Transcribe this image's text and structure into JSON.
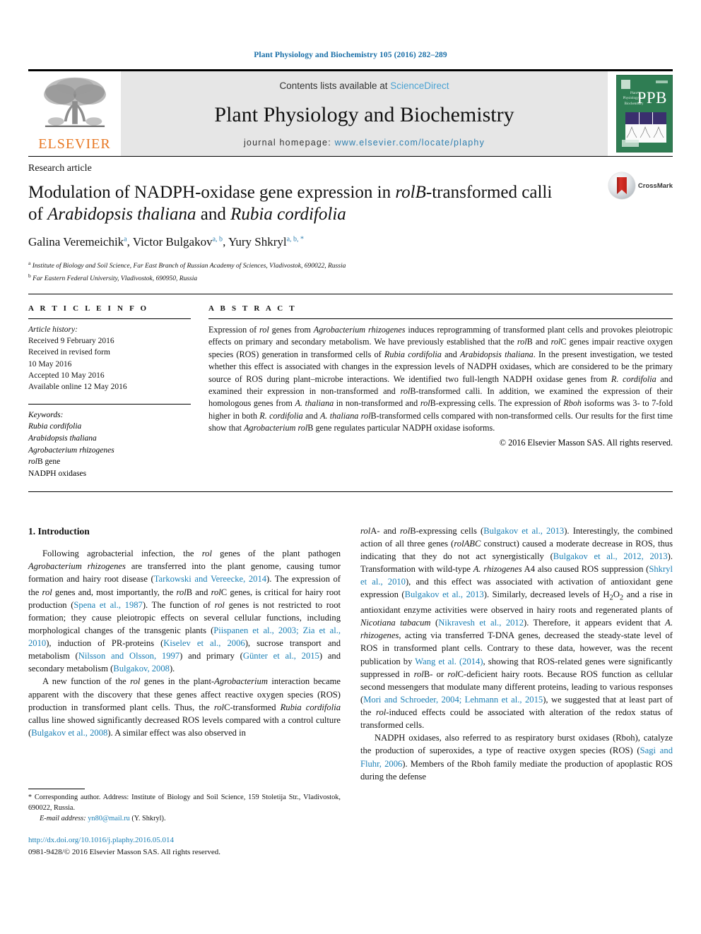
{
  "running_head": "Plant Physiology and Biochemistry 105 (2016) 282–289",
  "masthead": {
    "publisher_name": "ELSEVIER",
    "contents_prefix": "Contents lists available at ",
    "contents_link": "ScienceDirect",
    "journal_title": "Plant Physiology and Biochemistry",
    "homepage_prefix": "journal homepage: ",
    "homepage_link": "www.elsevier.com/locate/plaphy",
    "cover_acronym": "PPB",
    "cover_journal_name": "Plant Physiology and Biochemistry"
  },
  "article": {
    "type": "Research article",
    "title_part1": "Modulation of NADPH-oxidase gene expression in ",
    "title_italic1": "rolB",
    "title_part2": "-transformed calli of ",
    "title_italic2": "Arabidopsis thaliana",
    "title_part3": " and ",
    "title_italic3": "Rubia cordifolia",
    "authors": [
      {
        "name": "Galina Veremeichik",
        "sup": "a",
        "sep": ", "
      },
      {
        "name": "Victor Bulgakov",
        "sup": "a, b",
        "sep": ", "
      },
      {
        "name": "Yury Shkryl",
        "sup": "a, b, *",
        "sep": ""
      }
    ],
    "affiliations": [
      {
        "marker": "a",
        "text": "Institute of Biology and Soil Science, Far East Branch of Russian Academy of Sciences, Vladivostok, 690022, Russia"
      },
      {
        "marker": "b",
        "text": "Far Eastern Federal University, Vladivostok, 690950, Russia"
      }
    ],
    "crossmark_label": "CrossMark"
  },
  "info": {
    "heading": "A R T I C L E   I N F O",
    "history_label": "Article history:",
    "history": [
      "Received 9 February 2016",
      "Received in revised form",
      "10 May 2016",
      "Accepted 10 May 2016",
      "Available online 12 May 2016"
    ],
    "keywords_label": "Keywords:",
    "keywords": [
      {
        "text": "Rubia cordifolia",
        "italic": true
      },
      {
        "text": "Arabidopsis thaliana",
        "italic": true
      },
      {
        "text": "Agrobacterium rhizogenes",
        "italic": true
      },
      {
        "text": "rolB gene",
        "italic": false
      },
      {
        "text": "NADPH oxidases",
        "italic": false
      }
    ]
  },
  "abstract": {
    "heading": "A B S T R A C T",
    "body": "Expression of rol genes from Agrobacterium rhizogenes induces reprogramming of transformed plant cells and provokes pleiotropic effects on primary and secondary metabolism. We have previously established that the rolB and rolC genes impair reactive oxygen species (ROS) generation in transformed cells of Rubia cordifolia and Arabidopsis thaliana. In the present investigation, we tested whether this effect is associated with changes in the expression levels of NADPH oxidases, which are considered to be the primary source of ROS during plant–microbe interactions. We identified two full-length NADPH oxidase genes from R. cordifolia and examined their expression in non-transformed and rolB-transformed calli. In addition, we examined the expression of their homologous genes from A. thaliana in non-transformed and rolB-expressing cells. The expression of Rboh isoforms was 3- to 7-fold higher in both R. cordifolia and A. thaliana rolB-transformed cells compared with non-transformed cells. Our results for the first time show that Agrobacterium rolB gene regulates particular NADPH oxidase isoforms.",
    "copyright": "© 2016 Elsevier Masson SAS. All rights reserved."
  },
  "introduction": {
    "heading": "1.  Introduction",
    "left_paragraphs": [
      "Following agrobacterial infection, the rol genes of the plant pathogen Agrobacterium rhizogenes are transferred into the plant genome, causing tumor formation and hairy root disease (Tarkowski and Vereecke, 2014). The expression of the rol genes and, most importantly, the rolB and rolC genes, is critical for hairy root production (Spena et al., 1987). The function of rol genes is not restricted to root formation; they cause pleiotropic effects on several cellular functions, including morphological changes of the transgenic plants (Piispanen et al., 2003; Zia et al., 2010), induction of PR-proteins (Kiselev et al., 2006), sucrose transport and metabolism (Nilsson and Olsson, 1997) and primary (Günter et al., 2015) and secondary metabolism (Bulgakov, 2008).",
      "A new function of the rol genes in the plant-Agrobacterium interaction became apparent with the discovery that these genes affect reactive oxygen species (ROS) production in transformed plant cells. Thus, the rolC-transformed Rubia cordifolia callus line showed significantly decreased ROS levels compared with a control culture (Bulgakov et al., 2008). A similar effect was also observed in"
    ],
    "right_paragraphs": [
      "rolA- and rolB-expressing cells (Bulgakov et al., 2013). Interestingly, the combined action of all three genes (rolABC construct) caused a moderate decrease in ROS, thus indicating that they do not act synergistically (Bulgakov et al., 2012, 2013). Transformation with wild-type A. rhizogenes A4 also caused ROS suppression (Shkryl et al., 2010), and this effect was associated with activation of antioxidant gene expression (Bulgakov et al., 2013). Similarly, decreased levels of H2O2 and a rise in antioxidant enzyme activities were observed in hairy roots and regenerated plants of Nicotiana tabacum (Nikravesh et al., 2012). Therefore, it appears evident that A. rhizogenes, acting via transferred T-DNA genes, decreased the steady-state level of ROS in transformed plant cells. Contrary to these data, however, was the recent publication by Wang et al. (2014), showing that ROS-related genes were significantly suppressed in rolB- or rolC-deficient hairy roots. Because ROS function as cellular second messengers that modulate many different proteins, leading to various responses (Mori and Schroeder, 2004; Lehmann et al., 2015), we suggested that at least part of the rol-induced effects could be associated with alteration of the redox status of transformed cells.",
      "NADPH oxidases, also referred to as respiratory burst oxidases (Rboh), catalyze the production of superoxides, a type of reactive oxygen species (ROS) (Sagi and Fluhr, 2006). Members of the Rboh family mediate the production of apoplastic ROS during the defense"
    ]
  },
  "footnote": {
    "star": "*",
    "corresponding": " Corresponding author. Address: Institute of Biology and Soil Science, 159 Stoletija Str., Vladivostok, 690022, Russia.",
    "email_label": "E-mail address:",
    "email": "yn80@mail.ru",
    "email_owner": " (Y. Shkryl)."
  },
  "footer": {
    "doi": "http://dx.doi.org/10.1016/j.plaphy.2016.05.014",
    "issn_line": "0981-9428/© 2016 Elsevier Masson SAS. All rights reserved."
  },
  "colors": {
    "link_blue": "#1a7fb5",
    "sciencedirect_blue": "#4ba3d3",
    "elsevier_orange": "#e87722",
    "cover_green": "#2f7d53",
    "crossmark_red": "#c0241b"
  }
}
